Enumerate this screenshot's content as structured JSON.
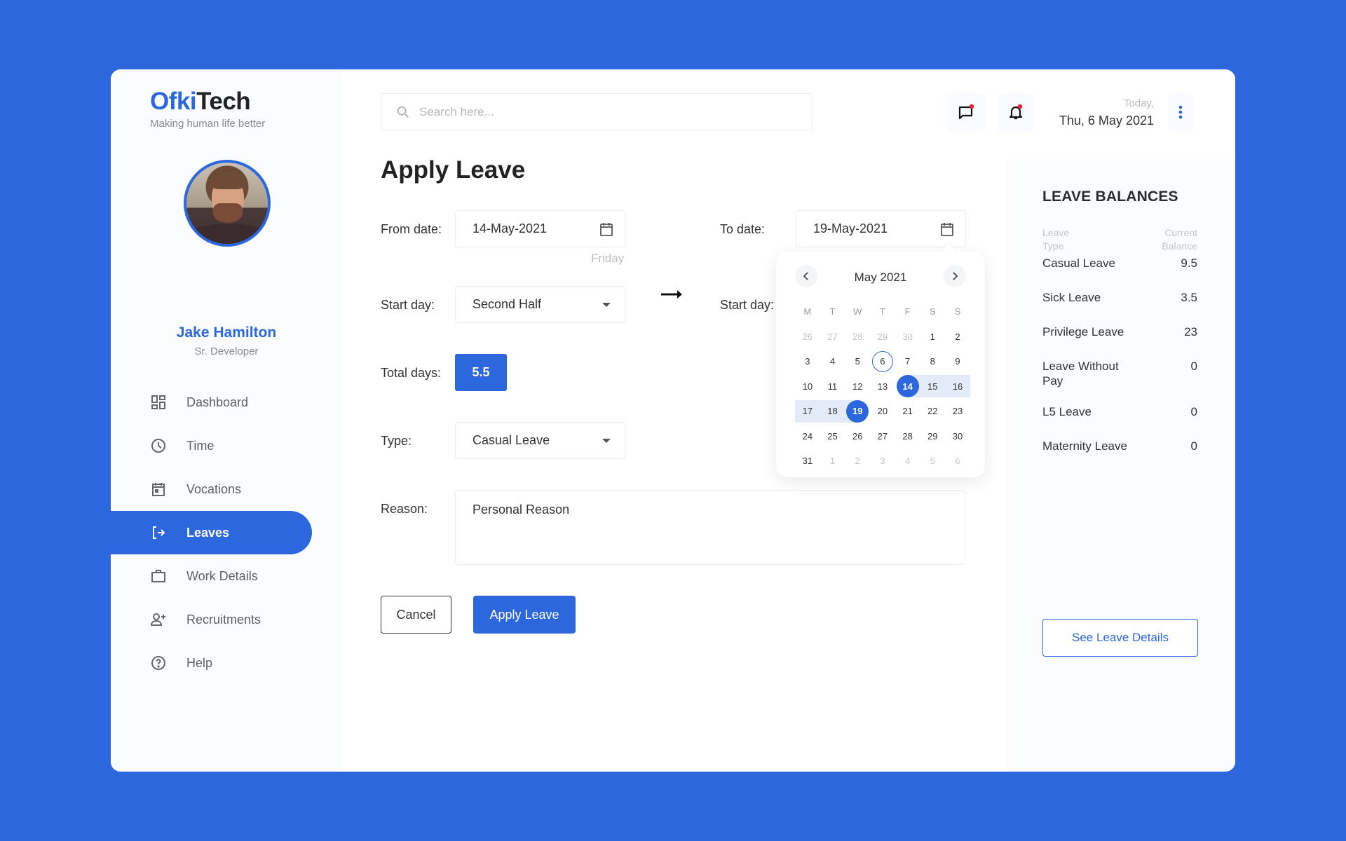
{
  "brand": {
    "name_part1": "Ofki",
    "name_part2": "Tech",
    "tagline": "Making human life better"
  },
  "user": {
    "name": "Jake Hamilton",
    "role": "Sr. Developer"
  },
  "sidebar": {
    "items": [
      {
        "label": "Dashboard",
        "icon": "dashboard-icon",
        "active": false
      },
      {
        "label": "Time",
        "icon": "clock-icon",
        "active": false
      },
      {
        "label": "Vocations",
        "icon": "calendar-icon",
        "active": false
      },
      {
        "label": "Leaves",
        "icon": "logout-icon",
        "active": true
      },
      {
        "label": "Work Details",
        "icon": "briefcase-icon",
        "active": false
      },
      {
        "label": "Recruitments",
        "icon": "add-user-icon",
        "active": false
      },
      {
        "label": "Help",
        "icon": "help-icon",
        "active": false
      }
    ]
  },
  "topbar": {
    "search_placeholder": "Search here...",
    "search_value": "",
    "today_label": "Today,",
    "today_date": "Thu, 6 May 2021",
    "messages_has_notification": true,
    "bell_has_notification": true
  },
  "form": {
    "title": "Apply Leave",
    "from_date_label": "From date:",
    "from_date_value": "14-May-2021",
    "from_date_weekday": "Friday",
    "to_date_label": "To date:",
    "to_date_value": "19-May-2021",
    "start_day_label": "Start day:",
    "start_day_value": "Second Half",
    "end_start_day_label": "Start day:",
    "total_days_label": "Total days:",
    "total_days_value": "5.5",
    "type_label": "Type:",
    "type_value": "Casual Leave",
    "reason_label": "Reason:",
    "reason_value": "Personal Reason",
    "cancel_label": "Cancel",
    "apply_label": "Apply Leave"
  },
  "calendar": {
    "title": "May 2021",
    "weekdays": [
      "M",
      "T",
      "W",
      "T",
      "F",
      "S",
      "S"
    ],
    "weeks": [
      [
        {
          "d": "26",
          "m": 1
        },
        {
          "d": "27",
          "m": 1
        },
        {
          "d": "28",
          "m": 1
        },
        {
          "d": "29",
          "m": 1
        },
        {
          "d": "30",
          "m": 1
        },
        {
          "d": "1"
        },
        {
          "d": "2"
        }
      ],
      [
        {
          "d": "3"
        },
        {
          "d": "4"
        },
        {
          "d": "5"
        },
        {
          "d": "6",
          "today": 1
        },
        {
          "d": "7"
        },
        {
          "d": "8"
        },
        {
          "d": "9"
        }
      ],
      [
        {
          "d": "10"
        },
        {
          "d": "11"
        },
        {
          "d": "12"
        },
        {
          "d": "13"
        },
        {
          "d": "14",
          "sel": 1,
          "rs": 1
        },
        {
          "d": "15",
          "r": 1
        },
        {
          "d": "16",
          "r": 1
        }
      ],
      [
        {
          "d": "17",
          "r": 1
        },
        {
          "d": "18",
          "r": 1
        },
        {
          "d": "19",
          "sel": 1,
          "re": 1
        },
        {
          "d": "20"
        },
        {
          "d": "21"
        },
        {
          "d": "22"
        },
        {
          "d": "23"
        }
      ],
      [
        {
          "d": "24"
        },
        {
          "d": "25"
        },
        {
          "d": "26"
        },
        {
          "d": "27"
        },
        {
          "d": "28"
        },
        {
          "d": "29"
        },
        {
          "d": "30"
        }
      ],
      [
        {
          "d": "31"
        },
        {
          "d": "1",
          "m": 1
        },
        {
          "d": "2",
          "m": 1
        },
        {
          "d": "3",
          "m": 1
        },
        {
          "d": "4",
          "m": 1
        },
        {
          "d": "5",
          "m": 1
        },
        {
          "d": "6",
          "m": 1
        }
      ]
    ],
    "range_start": "14",
    "range_end": "19",
    "today": "6"
  },
  "balances": {
    "title": "LEAVE BALANCES",
    "col_type": "Leave Type",
    "col_balance": "Current Balance",
    "rows": [
      {
        "type": "Casual Leave",
        "balance": "9.5"
      },
      {
        "type": "Sick Leave",
        "balance": "3.5"
      },
      {
        "type": "Privilege Leave",
        "balance": "23"
      },
      {
        "type": "Leave Without Pay",
        "balance": "0"
      },
      {
        "type": "L5 Leave",
        "balance": "0"
      },
      {
        "type": "Maternity Leave",
        "balance": "0"
      }
    ],
    "details_button": "See Leave Details"
  },
  "colors": {
    "accent": "#2c67dd",
    "background": "#2c67dd",
    "notification_dot": "#e8213b",
    "range_fill": "#e3eaf8"
  }
}
